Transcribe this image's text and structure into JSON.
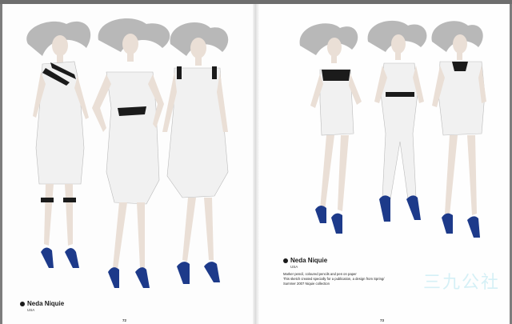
{
  "left_page": {
    "designer_name": "Neda Niquie",
    "designer_country": "USA",
    "page_number": "72"
  },
  "right_page": {
    "designer_name": "Neda Niquie",
    "designer_country": "USA",
    "description_lines": [
      "Marker pencil, coloured pencils and pen on paper",
      "This sketch created specially for a publication, a design from Spring/",
      "Summer 2007 Niquie collection"
    ],
    "page_number": "73"
  },
  "watermark": "三九公社",
  "colors": {
    "dress": "#f1f1f1",
    "shoe_blue": "#1d3a8a",
    "hair": "#8a8a8a",
    "skin": "#eadfd6"
  }
}
